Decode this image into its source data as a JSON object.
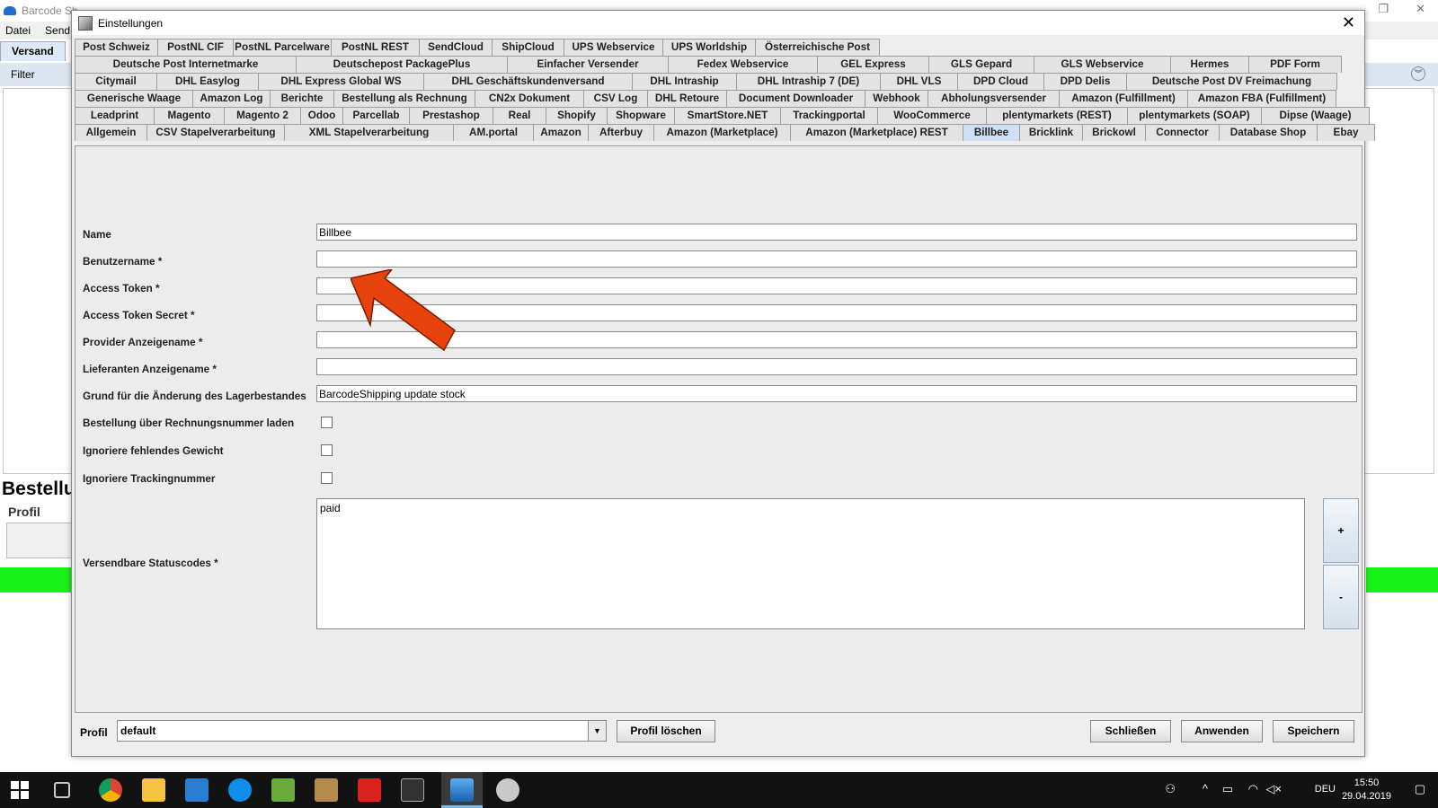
{
  "app": {
    "title": "Barcode Sh",
    "menu": [
      "Datei",
      "Send"
    ],
    "tab": "Versand",
    "filter_label": "Filter",
    "bestell_label": "Bestellu",
    "profil_label": "Profil"
  },
  "dialog": {
    "title": "Einstellungen",
    "tab_rows": [
      [
        "Post Schweiz",
        "PostNL CIF",
        "PostNL Parcelware",
        "PostNL REST",
        "SendCloud",
        "ShipCloud",
        "UPS Webservice",
        "UPS Worldship",
        "Österreichische Post"
      ],
      [
        "Deutsche Post Internetmarke",
        "Deutschepost PackagePlus",
        "Einfacher Versender",
        "Fedex Webservice",
        "GEL Express",
        "GLS Gepard",
        "GLS Webservice",
        "Hermes",
        "PDF Form"
      ],
      [
        "Citymail",
        "DHL Easylog",
        "DHL Express Global WS",
        "DHL Geschäftskundenversand",
        "DHL Intraship",
        "DHL Intraship 7 (DE)",
        "DHL VLS",
        "DPD Cloud",
        "DPD Delis",
        "Deutsche Post DV Freimachung"
      ],
      [
        "Generische Waage",
        "Amazon Log",
        "Berichte",
        "Bestellung als Rechnung",
        "CN2x Dokument",
        "CSV Log",
        "DHL Retoure",
        "Document Downloader",
        "Webhook",
        "Abholungsversender",
        "Amazon (Fulfillment)",
        "Amazon FBA (Fulfillment)"
      ],
      [
        "Leadprint",
        "Magento",
        "Magento 2",
        "Odoo",
        "Parcellab",
        "Prestashop",
        "Real",
        "Shopify",
        "Shopware",
        "SmartStore.NET",
        "Trackingportal",
        "WooCommerce",
        "plentymarkets (REST)",
        "plentymarkets (SOAP)",
        "Dipse (Waage)"
      ],
      [
        "Allgemein",
        "CSV Stapelverarbeitung",
        "XML Stapelverarbeitung",
        "AM.portal",
        "Amazon",
        "Afterbuy",
        "Amazon (Marketplace)",
        "Amazon (Marketplace) REST",
        "Billbee",
        "Bricklink",
        "Brickowl",
        "Connector",
        "Database Shop",
        "Ebay"
      ]
    ],
    "active_tab": "Billbee",
    "fields": {
      "name": {
        "label": "Name",
        "value": "Billbee"
      },
      "benutzername": {
        "label": "Benutzername *",
        "value": ""
      },
      "access_token": {
        "label": "Access Token *",
        "value": ""
      },
      "access_token_secret": {
        "label": "Access Token Secret *",
        "value": ""
      },
      "provider_anzeigename": {
        "label": "Provider Anzeigename *",
        "value": ""
      },
      "lieferanten_anzeigename": {
        "label": "Lieferanten Anzeigename *",
        "value": ""
      },
      "grund": {
        "label": "Grund für die Änderung des Lagerbestandes",
        "value": "BarcodeShipping update stock"
      }
    },
    "checkboxes": {
      "rechnungsnummer": {
        "label": "Bestellung über Rechnungsnummer laden",
        "checked": false
      },
      "gewicht": {
        "label": "Ignoriere fehlendes Gewicht",
        "checked": false
      },
      "tracking": {
        "label": "Ignoriere Trackingnummer",
        "checked": false
      }
    },
    "statuscodes": {
      "label": "Versendbare Statuscodes *",
      "items": [
        "paid"
      ],
      "add_label": "+",
      "remove_label": "-"
    },
    "footer": {
      "profil_label": "Profil",
      "profil_value": "default",
      "delete_label": "Profil löschen",
      "close_label": "Schließen",
      "apply_label": "Anwenden",
      "save_label": "Speichern"
    }
  },
  "taskbar": {
    "lang": "DEU",
    "time": "15:50",
    "date": "29.04.2019"
  },
  "colors": {
    "arrow": "#e8420c",
    "active_tab": "#cfe0f5",
    "status_green": "#19f219"
  }
}
